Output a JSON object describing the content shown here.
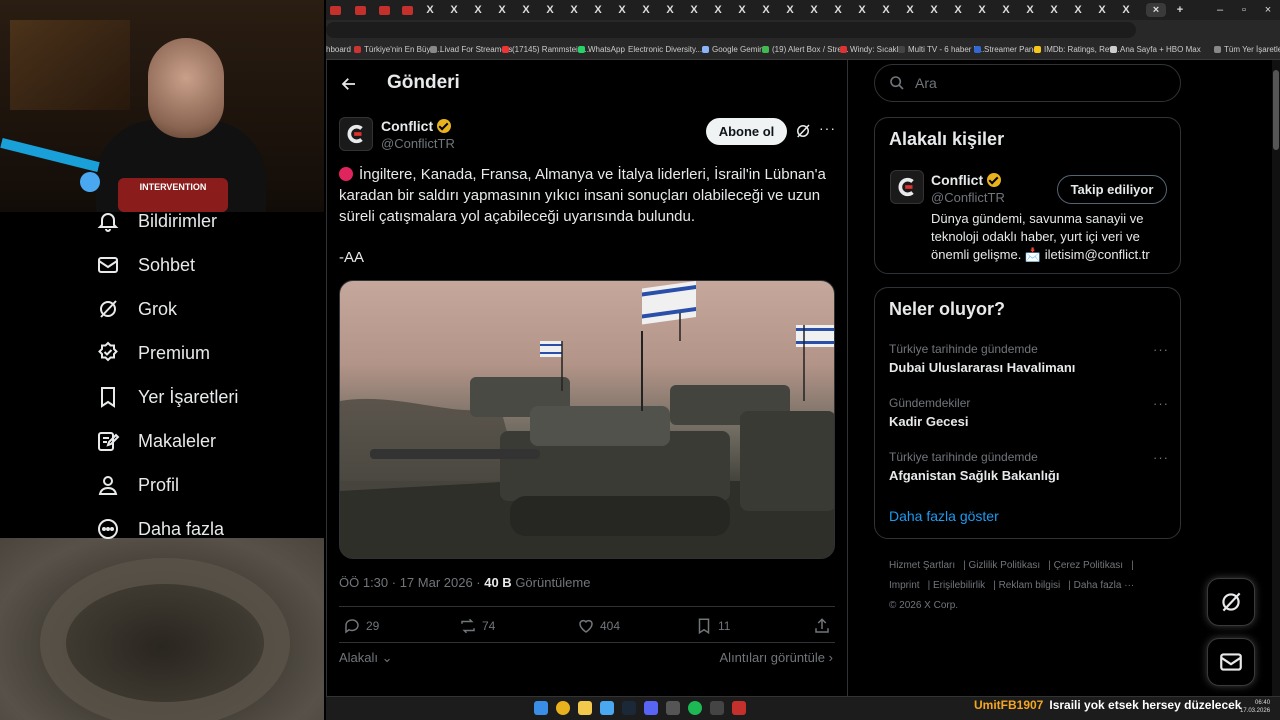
{
  "browser": {
    "bookmarks": [
      "hboard",
      "Türkiye'nin En Büyü...",
      "Livad For Streamers",
      "(17145) Rammstein...",
      "WhatsApp",
      "Electronic Diversity...",
      "Google Gemini",
      "(19) Alert Box / Stre...",
      "Windy: Sıcaklık",
      "Multi TV - 6 haber k...",
      "Streamer Panel",
      "IMDb: Ratings, Revi...",
      "Ana Sayfa + HBO Max",
      "Tüm Yer İşaretleri"
    ],
    "tab_letter": "X"
  },
  "webcam": {
    "shirt_text": "INTERVENTION"
  },
  "nav": {
    "items": [
      {
        "label": "Bildirimler",
        "icon": "bell-icon"
      },
      {
        "label": "Sohbet",
        "icon": "mail-icon"
      },
      {
        "label": "Grok",
        "icon": "grok-icon"
      },
      {
        "label": "Premium",
        "icon": "premium-icon"
      },
      {
        "label": "Yer İşaretleri",
        "icon": "bookmark-icon"
      },
      {
        "label": "Makaleler",
        "icon": "articles-icon"
      },
      {
        "label": "Profil",
        "icon": "profile-icon"
      },
      {
        "label": "Daha fazla",
        "icon": "more-circle-icon"
      }
    ]
  },
  "post": {
    "header_title": "Gönderi",
    "author_name": "Conflict",
    "author_handle": "@ConflictTR",
    "subscribe_label": "Abone ol",
    "text": "İngiltere, Kanada, Fransa, Almanya ve İtalya liderleri, İsrail'in Lübnan'a karadan bir saldırı yapmasının yıkıcı insani sonuçları olabileceği ve uzun süreli çatışmalara yol açabileceği uyarısında bulundu.",
    "signature": "-AA",
    "time": "ÖÖ 1:30 · 17 Mar 2026 · ",
    "views_count": "40 B",
    "views_label": " Görüntüleme",
    "replies": "29",
    "reposts": "74",
    "likes": "404",
    "bookmarks": "11",
    "related_label": "Alakalı",
    "quotes_label": "Alıntıları görüntüle"
  },
  "sidebar": {
    "search_placeholder": "Ara",
    "related_title": "Alakalı kişiler",
    "related_person": {
      "name": "Conflict",
      "handle": "@ConflictTR",
      "follow_label": "Takip ediliyor",
      "bio": "Dünya gündemi, savunma sanayii ve teknoloji odaklı haber, yurt içi veri ve önemli gelişme. 📩 iletisim@conflict.tr"
    },
    "trends_title": "Neler oluyor?",
    "trends": [
      {
        "context": "Türkiye tarihinde gündemde",
        "name": "Dubai Uluslararası Havalimanı"
      },
      {
        "context": "Gündemdekiler",
        "name": "Kadir Gecesi"
      },
      {
        "context": "Türkiye tarihinde gündemde",
        "name": "Afganistan Sağlık Bakanlığı"
      }
    ],
    "show_more": "Daha fazla göster",
    "footer_links": [
      "Hizmet Şartları",
      "Gizlilik Politikası",
      "Çerez Politikası",
      "Imprint",
      "Erişilebilirlik",
      "Reklam bilgisi",
      "Daha fazla ···"
    ],
    "copyright": "© 2026 X Corp."
  },
  "stream": {
    "chat_user": "UmitFB1907",
    "chat_message": "Israili yok etsek hersey düzelecek",
    "clock_time": "06:40",
    "clock_date": "17.03.2026"
  },
  "colors": {
    "accent": "#1d9bf0",
    "background": "#000000",
    "verified": "#e8b21f",
    "border": "#2f3336"
  }
}
